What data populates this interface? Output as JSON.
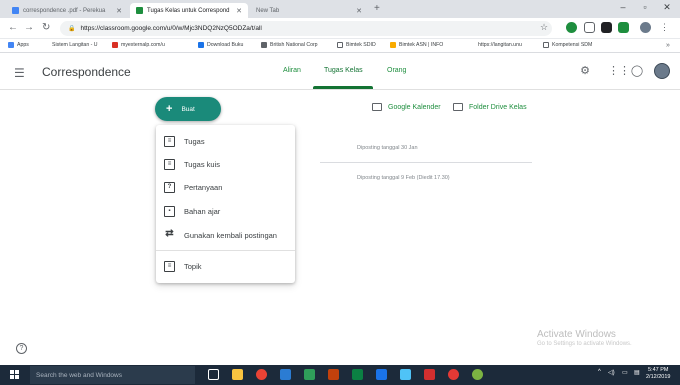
{
  "browser": {
    "tabs": [
      {
        "title": "correspondence .pdf - Perekua"
      },
      {
        "title": "Tugas Kelas untuk Correspond"
      },
      {
        "title": "New Tab"
      }
    ],
    "url": "https://classroom.google.com/u/0/w/Mjc3NDQ2NzQ5ODZa/t/all",
    "bookmarks": [
      "Apps",
      "Sistem Langitan - U",
      "myexternalp.com/u",
      "Download Buku",
      "British National Corp",
      "Bimtek SDID",
      "Bimtek ASN | INFO",
      "https://langitan.unu",
      "Kompetensi SDM"
    ]
  },
  "app": {
    "title": "Correspondence",
    "nav_tabs": [
      "Aliran",
      "Tugas Kelas",
      "Orang"
    ],
    "active_tab": "Tugas Kelas"
  },
  "main": {
    "create_button": "Buat",
    "calendar_link": "Google Kalender",
    "drive_link": "Folder Drive Kelas",
    "posted_1": "Diposting tanggal 30 Jan",
    "posted_2": "Diposting tanggal 9 Feb (Diedit 17.30)"
  },
  "menu": {
    "items": [
      "Tugas",
      "Tugas kuis",
      "Pertanyaan",
      "Bahan ajar",
      "Gunakan kembali postingan",
      "Topik"
    ]
  },
  "watermark": {
    "line1": "Activate Windows",
    "line2": "Go to Settings to activate Windows."
  },
  "taskbar": {
    "search_placeholder": "Search the web and Windows",
    "time": "5:47 PM",
    "date": "2/12/2019"
  },
  "colors": {
    "accent": "#1a8a7a",
    "green": "#1e8e3e",
    "taskbar": "#1c2a3a"
  }
}
